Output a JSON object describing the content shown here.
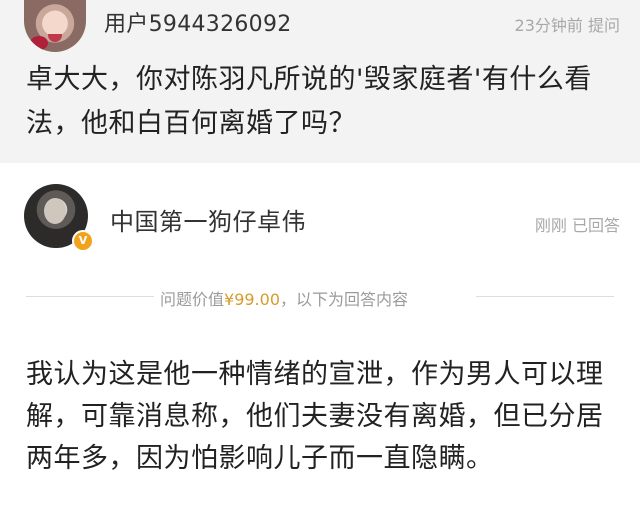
{
  "question": {
    "username": "用户5944326092",
    "meta": "23分钟前 提问",
    "text": "卓大大，你对陈羽凡所说的'毁家庭者'有什么看法，他和白百何离婚了吗？"
  },
  "answer": {
    "author_name": "中国第一狗仔卓伟",
    "verified_badge": "V",
    "meta": "刚刚 已回答",
    "divider_prefix": "问题价值",
    "price": "¥99.00",
    "divider_suffix": "，以下为回答内容",
    "text": "我认为这是他一种情绪的宣泄，作为男人可以理解，可靠消息称，他们夫妻没有离婚，但已分居两年多，因为怕影响儿子而一直隐瞒。"
  },
  "colors": {
    "question_bg": "#f3f3f3",
    "meta_gray": "#a8a8a8",
    "price_accent": "#d99a2b",
    "badge": "#f2a31c"
  }
}
